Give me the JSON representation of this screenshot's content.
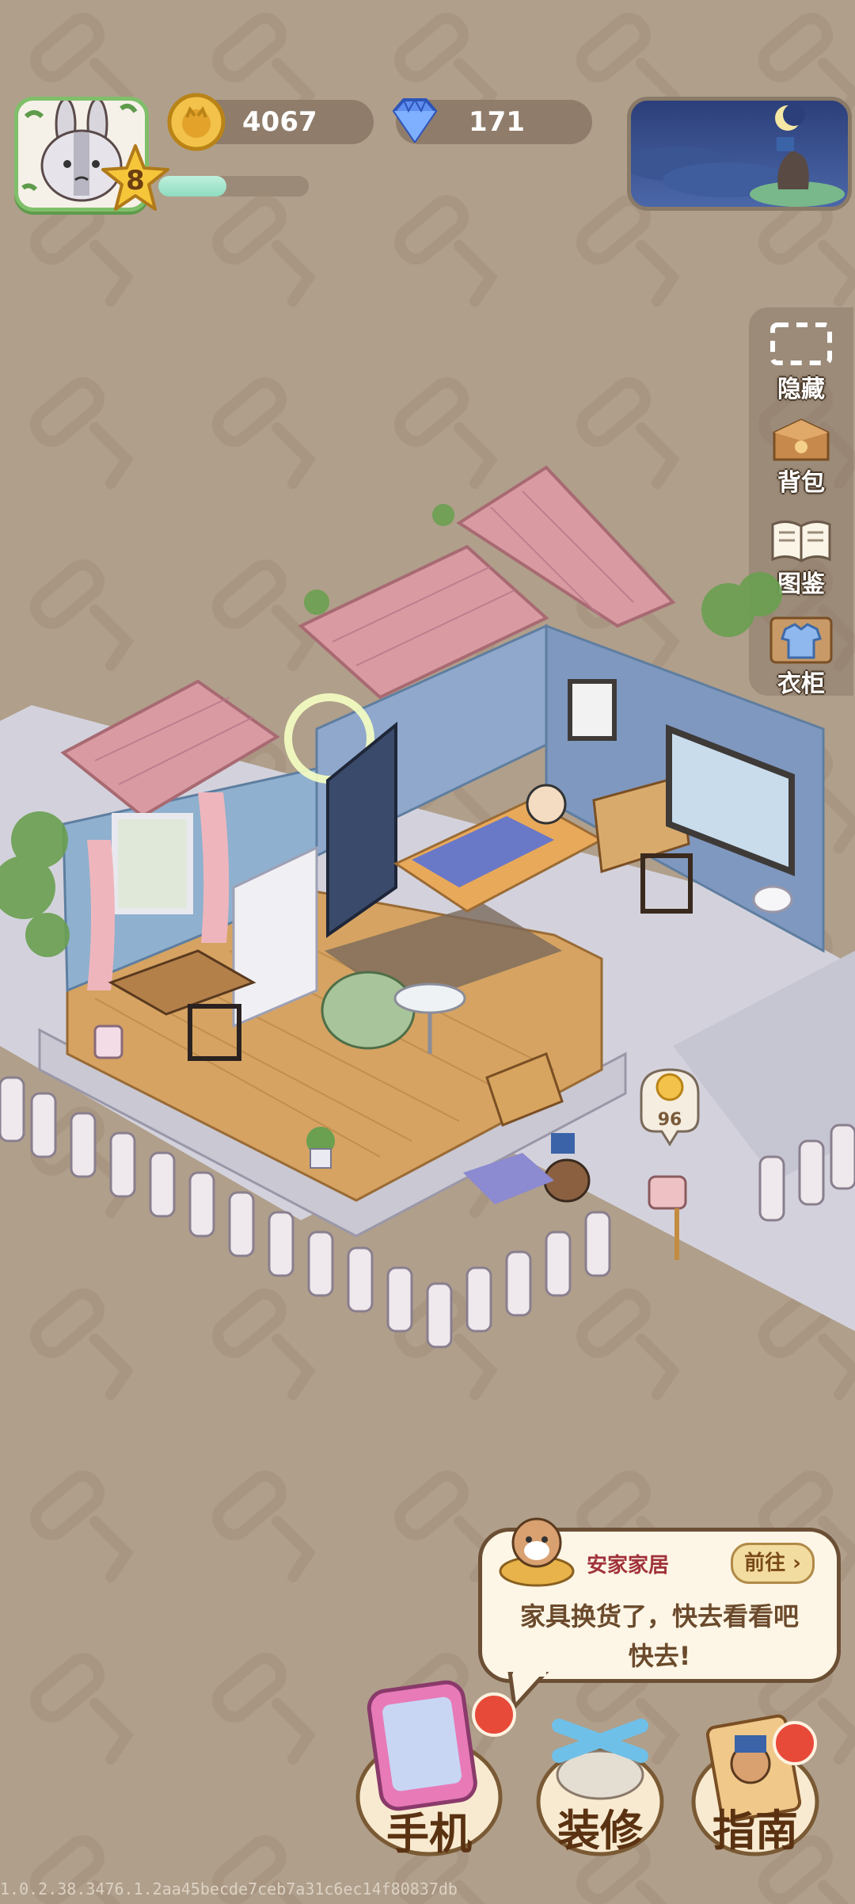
{
  "hud": {
    "player_level": "8",
    "xp_progress": 0.45,
    "coins": "4067",
    "gems": "171",
    "time_of_day": "night"
  },
  "side_menu": {
    "hide": "隐藏",
    "backpack": "背包",
    "catalog": "图鉴",
    "wardrobe": "衣柜"
  },
  "scene": {
    "coin_bubble_value": "96"
  },
  "notification": {
    "title": "安家家居",
    "goto_label": "前往",
    "line1": "家具换货了，快去看看吧",
    "line2": "快去!"
  },
  "bottom_bar": {
    "phone": "手机",
    "decorate": "装修",
    "guide": "指南"
  },
  "version": "1.0.2.38.3476.1.2aa45becde7ceb7a31c6ec14f80837db",
  "colors": {
    "background": "#b09f8b",
    "roof": "#d99aa2",
    "wall": "#8fb0cf",
    "floor": "#d6a362",
    "accent_red": "#e84a3a"
  }
}
